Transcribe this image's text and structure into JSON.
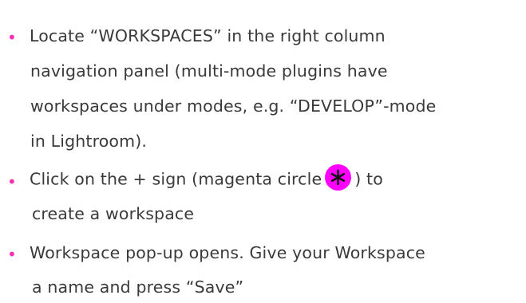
{
  "bullet_glyph": "•",
  "accent_color": "#ff2fb4",
  "icon_color": "#ff00ff",
  "steps": [
    {
      "lines": [
        "Locate “WORKSPACES” in the right column",
        "navigation panel (multi-mode plugins have",
        "workspaces under modes, e.g. “DEVELOP”-mode",
        "in Lightroom)."
      ]
    },
    {
      "line1_before": "Click on the + sign (magenta circle",
      "line1_after": ") to",
      "icon": "asterisk-icon",
      "lines_rest": [
        "create a workspace"
      ]
    },
    {
      "lines": [
        "Workspace pop-up opens. Give your Workspace",
        "a name and press “Save”"
      ]
    }
  ]
}
